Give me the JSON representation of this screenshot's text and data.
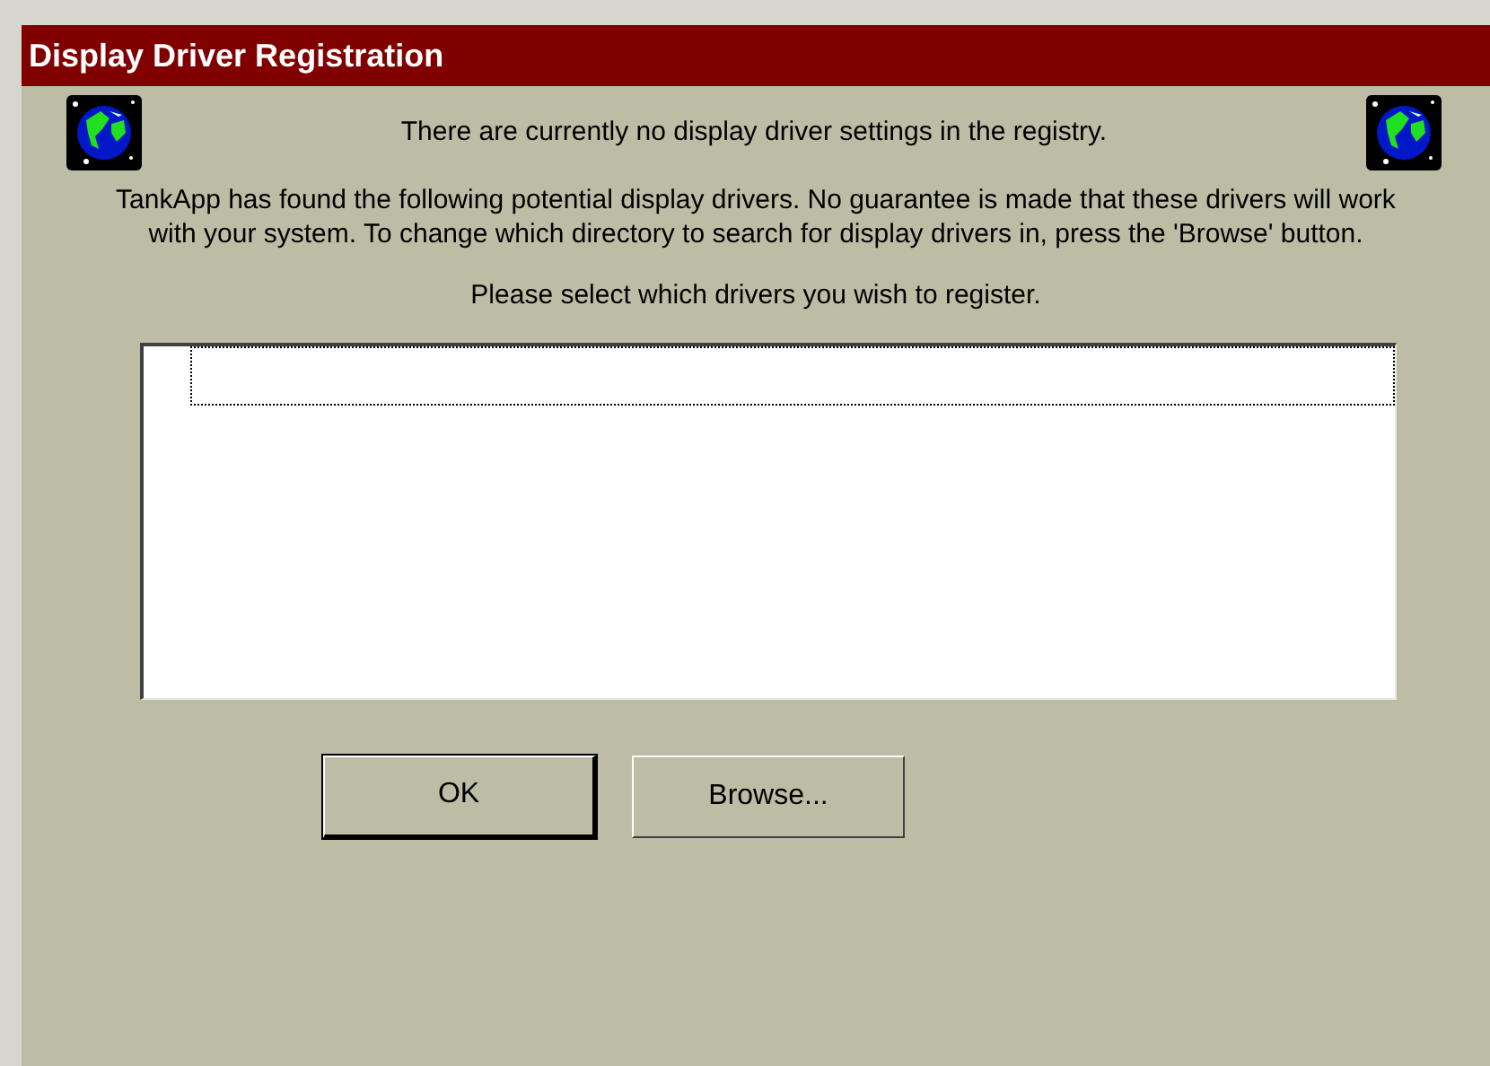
{
  "window": {
    "title": "Display Driver Registration"
  },
  "status_message": "There are currently no display driver settings in the registry.",
  "description": "TankApp has found the following potential display drivers. No guarantee is made that these drivers will work with your system. To change which directory to search for display drivers in, press the 'Browse' button.",
  "instruction": "Please select which drivers you wish to register.",
  "buttons": [
    {
      "label": "OK",
      "default": true
    },
    {
      "label": "Browse...",
      "default": false
    }
  ]
}
